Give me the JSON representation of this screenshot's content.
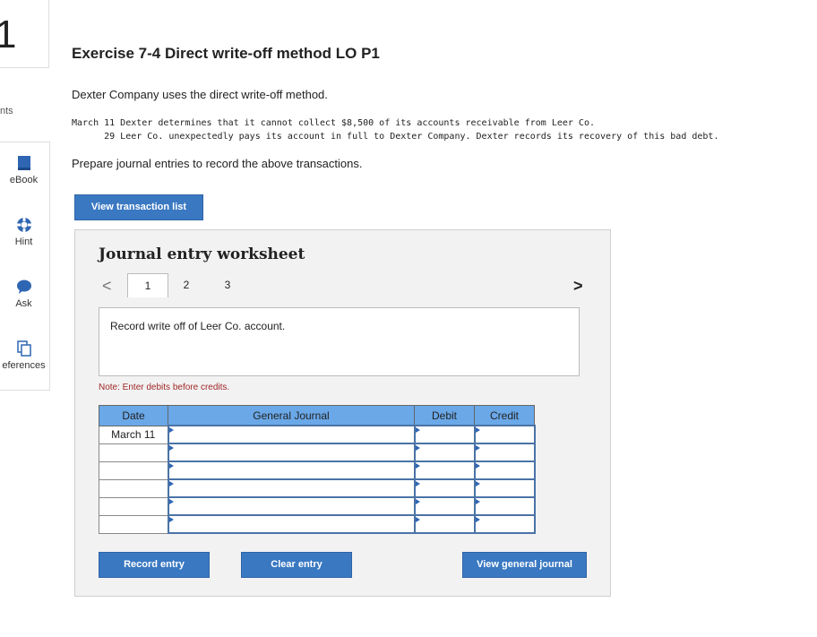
{
  "question_number": "1",
  "points_label": "nts",
  "sidebar": [
    {
      "label": "eBook",
      "icon": "ebook-icon"
    },
    {
      "label": "Hint",
      "icon": "hint-icon"
    },
    {
      "label": "Ask",
      "icon": "ask-icon"
    },
    {
      "label": "eferences",
      "icon": "references-icon"
    }
  ],
  "exercise_title": "Exercise 7-4 Direct write-off method LO P1",
  "intro_text": "Dexter Company uses the direct write-off method.",
  "transactions": [
    "March 11 Dexter determines that it cannot collect $8,500 of its accounts receivable from Leer Co.",
    "      29 Leer Co. unexpectedly pays its account in full to Dexter Company. Dexter records its recovery of this bad debt."
  ],
  "instructions": "Prepare journal entries to record the above transactions.",
  "view_transaction_list_label": "View transaction list",
  "worksheet": {
    "title": "Journal entry worksheet",
    "tabs": [
      "1",
      "2",
      "3"
    ],
    "active_tab": "1",
    "prev_arrow": "<",
    "next_arrow": ">",
    "description": "Record write off of Leer Co. account.",
    "note": "Note: Enter debits before credits.",
    "columns": {
      "date": "Date",
      "journal": "General Journal",
      "debit": "Debit",
      "credit": "Credit"
    },
    "rows": [
      {
        "date": "March 11",
        "journal": "",
        "debit": "",
        "credit": ""
      },
      {
        "date": "",
        "journal": "",
        "debit": "",
        "credit": ""
      },
      {
        "date": "",
        "journal": "",
        "debit": "",
        "credit": ""
      },
      {
        "date": "",
        "journal": "",
        "debit": "",
        "credit": ""
      },
      {
        "date": "",
        "journal": "",
        "debit": "",
        "credit": ""
      },
      {
        "date": "",
        "journal": "",
        "debit": "",
        "credit": ""
      }
    ],
    "record_entry_label": "Record entry",
    "clear_entry_label": "Clear entry",
    "view_general_journal_label": "View general journal"
  }
}
